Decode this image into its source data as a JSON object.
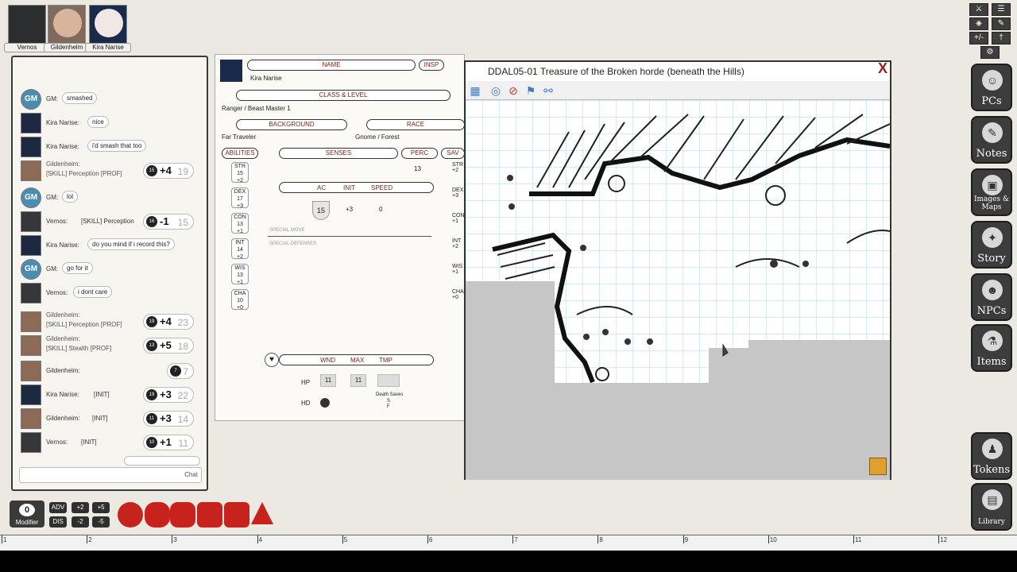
{
  "portraits": [
    {
      "name": "Vernos"
    },
    {
      "name": "Gildenhelm"
    },
    {
      "name": "Kira Narise"
    }
  ],
  "chat": {
    "messages": [
      {
        "speaker": "GM:",
        "text": "smashed",
        "type": "gm"
      },
      {
        "speaker": "Kira Narise:",
        "text": "nice",
        "type": "kira"
      },
      {
        "speaker": "Kira Narise:",
        "text": "i'd smash that too",
        "type": "kira"
      },
      {
        "speaker": "Gildenheim:",
        "line2": "[SKILL] Perception [PROF]",
        "die": "15",
        "mod": "+4",
        "total": "19",
        "type": "gild"
      },
      {
        "speaker": "GM:",
        "text": "lol",
        "type": "gm"
      },
      {
        "speaker": "Vernos:",
        "line": "[SKILL] Perception",
        "die": "16",
        "mod": "-1",
        "total": "15",
        "type": "vern"
      },
      {
        "speaker": "Kira Narise:",
        "text": "do you mind if i record this?",
        "type": "kira"
      },
      {
        "speaker": "GM:",
        "text": "go for it",
        "type": "gm"
      },
      {
        "speaker": "Vernos:",
        "text": "i dont care",
        "type": "vern"
      },
      {
        "speaker": "Gildenheim:",
        "line2": "[SKILL] Perception [PROF]",
        "die": "19",
        "mod": "+4",
        "total": "23",
        "type": "gild"
      },
      {
        "speaker": "Gildenheim:",
        "line2": "[SKILL] Stealth [PROF]",
        "die": "13",
        "mod": "+5",
        "total": "18",
        "type": "gild"
      },
      {
        "speaker": "Gildenheim:",
        "die": "7",
        "total": "7",
        "type": "gild"
      },
      {
        "speaker": "Kira Narise:",
        "line": "[INIT]",
        "die": "19",
        "mod": "+3",
        "total": "22",
        "type": "kira"
      },
      {
        "speaker": "Gildenheim:",
        "line": "[INIT]",
        "die": "11",
        "mod": "+3",
        "total": "14",
        "type": "gild"
      },
      {
        "speaker": "Vernos:",
        "line": "[INIT]",
        "die": "10",
        "mod": "+1",
        "total": "11",
        "type": "vern"
      }
    ],
    "gm_label": "GM",
    "send_label": "Chat"
  },
  "sheet": {
    "name_label": "NAME",
    "insp_label": "INSP",
    "name_value": "Kira Narise",
    "class_label": "CLASS & LEVEL",
    "class_value": "Ranger / Beast Master 1",
    "background_label": "BACKGROUND",
    "background_value": "Far Traveler",
    "race_label": "RACE",
    "race_value": "Gnome / Forest",
    "abilities_label": "ABILITIES",
    "senses_label": "SENSES",
    "perc_label": "PERC",
    "perc_value": "13",
    "sav_label": "SAV",
    "abilities": [
      {
        "abbr": "STR",
        "score": "15",
        "mod": "+2"
      },
      {
        "abbr": "DEX",
        "score": "17",
        "mod": "+3"
      },
      {
        "abbr": "CON",
        "score": "13",
        "mod": "+1"
      },
      {
        "abbr": "INT",
        "score": "14",
        "mod": "+2"
      },
      {
        "abbr": "WIS",
        "score": "13",
        "mod": "+1"
      },
      {
        "abbr": "CHA",
        "score": "10",
        "mod": "+0"
      }
    ],
    "saves": [
      {
        "abbr": "STR",
        "mod": "+2"
      },
      {
        "abbr": "DEX",
        "mod": "+3"
      },
      {
        "abbr": "CON",
        "mod": "+1"
      },
      {
        "abbr": "INT",
        "mod": "+2"
      },
      {
        "abbr": "WIS",
        "mod": "+1"
      },
      {
        "abbr": "CHA",
        "mod": "+0"
      }
    ],
    "ac_label": "AC",
    "init_label": "INIT",
    "speed_label": "SPEED",
    "ac_value": "15",
    "init_value": "+3",
    "speed_value": "0",
    "special_move": "SPECIAL MOVE",
    "special_defenses": "SPECIAL DEFENSES",
    "wnd_label": "WND",
    "max_label": "MAX",
    "tmp_label": "TMP",
    "hp_label": "HP",
    "hp_wnd": "11",
    "hp_max": "11",
    "hd_label": "HD",
    "death_saves": "Death Saves",
    "ds_s": "S",
    "ds_f": "F"
  },
  "map": {
    "title": "DDAL05-01 Treasure of the Broken horde (beneath the Hills)",
    "close_glyph": "X"
  },
  "sidebar": {
    "buttons": [
      {
        "label": "PCs",
        "icon": "pcs-icon"
      },
      {
        "label": "Notes",
        "icon": "notes-icon"
      },
      {
        "label": "Images & Maps",
        "icon": "images-icon"
      },
      {
        "label": "Story",
        "icon": "story-icon"
      },
      {
        "label": "NPCs",
        "icon": "npcs-icon"
      },
      {
        "label": "Items",
        "icon": "items-icon"
      },
      {
        "label": "Tokens",
        "icon": "tokens-icon"
      },
      {
        "label": "Library",
        "icon": "library-icon"
      }
    ],
    "top_buttons": [
      "+/-"
    ]
  },
  "dice_bar": {
    "modifier_value": "0",
    "modifier_label": "Modifier",
    "adv": "ADV",
    "dis": "DIS",
    "plus2": "+2",
    "plus5": "+5",
    "minus2": "-2",
    "minus5": "-5",
    "dice": [
      "d20",
      "d12",
      "d10",
      "d8",
      "d6",
      "d4"
    ]
  },
  "ruler": {
    "labels": [
      "1",
      "2",
      "3",
      "4",
      "5",
      "6",
      "7",
      "8",
      "9",
      "10",
      "11",
      "12"
    ]
  }
}
